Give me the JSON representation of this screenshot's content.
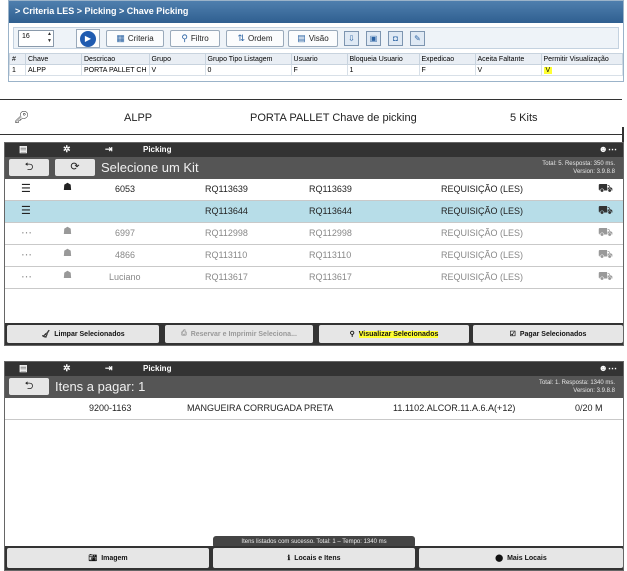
{
  "criteria_window": {
    "breadcrumb": "> Criteria LES > Picking > Chave Picking",
    "toolbar": {
      "rows_value": "16",
      "criteria_label": "Criteria",
      "filtro_label": "Filtro",
      "ordem_label": "Ordem",
      "visao_label": "Visão"
    },
    "grid": {
      "columns": [
        "#",
        "Chave",
        "Descricao",
        "Grupo",
        "Grupo Tipo Listagem",
        "Usuario",
        "Bloqueia Usuario",
        "Expedicao",
        "Aceita Faltante",
        "Permitir Visualização"
      ],
      "row": [
        "1",
        "ALPP",
        "PORTA PALLET CH",
        "V",
        "0",
        "F",
        "1",
        "F",
        "V",
        "V"
      ]
    }
  },
  "key_row": {
    "key": "ALPP",
    "description": "PORTA PALLET Chave de picking",
    "kits": "5 Kits"
  },
  "kit_screen": {
    "app_title": "Picking",
    "header_title": "Selecione um Kit",
    "meta_line1": "Total: 5. Resposta: 350 ms.",
    "meta_line2": "Version: 3.9.8.8",
    "rows": [
      {
        "user": "6053",
        "req1": "RQ113639",
        "req2": "RQ113639",
        "type": "REQUISIÇÃO (LES)"
      },
      {
        "user": "",
        "req1": "RQ113644",
        "req2": "RQ113644",
        "type": "REQUISIÇÃO (LES)"
      },
      {
        "user": "6997",
        "req1": "RQ112998",
        "req2": "RQ112998",
        "type": "REQUISIÇÃO (LES)"
      },
      {
        "user": "4866",
        "req1": "RQ113110",
        "req2": "RQ113110",
        "type": "REQUISIÇÃO (LES)"
      },
      {
        "user": "Luciano",
        "req1": "RQ113617",
        "req2": "RQ113617",
        "type": "REQUISIÇÃO (LES)"
      }
    ],
    "buttons": {
      "clear": "Limpar Selecionados",
      "reserve": "Reservar e Imprimir Seleciona...",
      "view": "Visualizar Selecionados",
      "pay": "Pagar Selecionados"
    }
  },
  "items_screen": {
    "app_title": "Picking",
    "header_title": "Itens a pagar: 1",
    "meta_line1": "Total: 1. Resposta: 1340 ms.",
    "meta_line2": "Version: 3.9.8.8",
    "item": {
      "code": "9200-1163",
      "description": "MANGUEIRA CORRUGADA PRETA",
      "location": "11.1102.ALCOR.11.A.6.A(+12)",
      "quantity": "0/20 M"
    },
    "toast": "Itens listados com sucesso. Total: 1 – Tempo: 1340 ms",
    "buttons": {
      "image": "Imagem",
      "locations": "Locais e Itens",
      "more": "Mais Locais"
    }
  }
}
